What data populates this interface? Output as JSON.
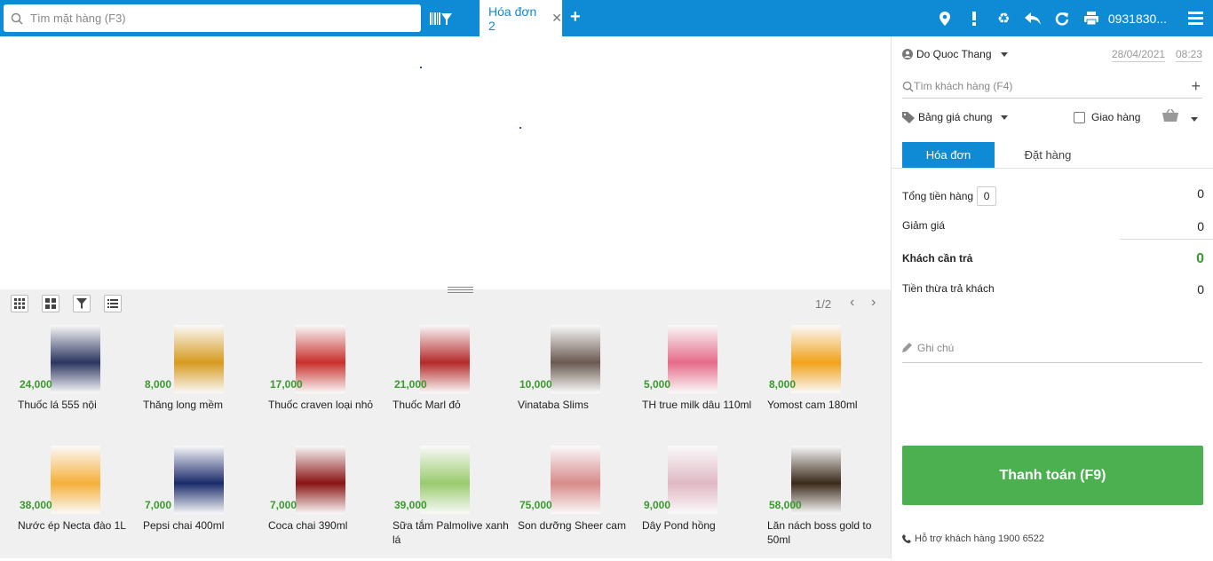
{
  "search": {
    "placeholder": "Tìm mặt hàng (F3)"
  },
  "tab": {
    "label": "Hóa đơn 2"
  },
  "phone": "0931830...",
  "pager": "1/2",
  "products": [
    {
      "price": "24,000",
      "name": "Thuốc lá 555 nội",
      "color": "#2b3560"
    },
    {
      "price": "8,000",
      "name": "Thăng long mềm",
      "color": "#d79a1f"
    },
    {
      "price": "17,000",
      "name": "Thuốc craven loại nhỏ",
      "color": "#c9302c"
    },
    {
      "price": "21,000",
      "name": "Thuốc Marl đỏ",
      "color": "#b52a2a"
    },
    {
      "price": "10,000",
      "name": "Vinataba Slims",
      "color": "#6a5a52"
    },
    {
      "price": "5,000",
      "name": "TH true milk dâu 110ml",
      "color": "#e66b8a"
    },
    {
      "price": "8,000",
      "name": "Yomost cam 180ml",
      "color": "#f1a21b"
    },
    {
      "price": "38,000",
      "name": "Nước ép Necta đào 1L",
      "color": "#f6b03a"
    },
    {
      "price": "7,000",
      "name": "Pepsi chai 400ml",
      "color": "#1a2b6a"
    },
    {
      "price": "7,000",
      "name": "Coca chai 390ml",
      "color": "#8a1414"
    },
    {
      "price": "39,000",
      "name": "Sữa tắm Palmolive xanh lá",
      "color": "#9acb6e"
    },
    {
      "price": "75,000",
      "name": "Son dưỡng Sheer cam",
      "color": "#d88b8b"
    },
    {
      "price": "9,000",
      "name": "Dây Pond hồng",
      "color": "#e0b8c4"
    },
    {
      "price": "58,000",
      "name": "Lăn nách boss gold to 50ml",
      "color": "#3a2a1a"
    }
  ],
  "right": {
    "user": "Do Quoc Thang",
    "date": "28/04/2021",
    "time": "08:23",
    "customer_placeholder": "Tìm khách hàng (F4)",
    "price_list": "Bảng giá chung",
    "delivery": "Giao hàng",
    "tab_invoice": "Hóa đơn",
    "tab_order": "Đặt hàng",
    "total_label": "Tổng tiền hàng",
    "total_qty": "0",
    "total_value": "0",
    "discount_label": "Giảm giá",
    "discount_value": "0",
    "pay_label": "Khách cần trả",
    "pay_value": "0",
    "change_label": "Tiền thừa trả khách",
    "change_value": "0",
    "note_placeholder": "Ghi chú",
    "pay_button": "Thanh toán (F9)",
    "support": "Hỗ trợ khách hàng 1900 6522"
  },
  "colors": {
    "brand": "#0f8bd6",
    "pay": "#4caf50",
    "price": "#3a9a2d"
  }
}
